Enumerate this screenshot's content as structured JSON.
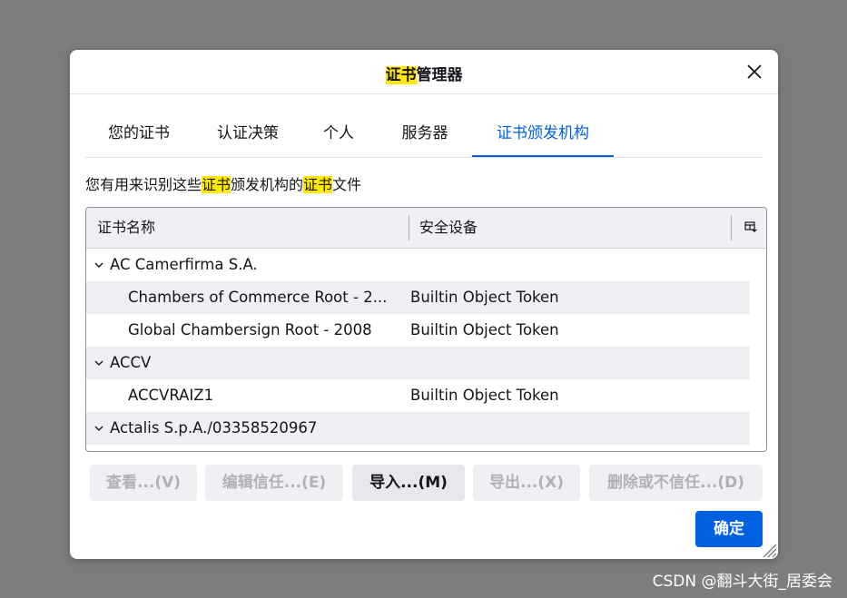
{
  "dialog": {
    "title_highlight": "证书",
    "title_rest": "管理器"
  },
  "tabs": [
    {
      "label": "您的证书"
    },
    {
      "label": "认证决策"
    },
    {
      "label": "个人"
    },
    {
      "label": "服务器"
    },
    {
      "label": "证书颁发机构",
      "selected": true
    }
  ],
  "description": {
    "part1": "您有用来识别这些",
    "hl1": "证书",
    "part2": "颁发机构的",
    "hl2": "证书",
    "part3": "文件"
  },
  "tree": {
    "columns": [
      "证书名称",
      "安全设备"
    ],
    "rows": [
      {
        "type": "group",
        "name": "AC Camerfirma S.A.",
        "token": ""
      },
      {
        "type": "item",
        "name": "Chambers of Commerce Root - 2...",
        "token": "Builtin Object Token"
      },
      {
        "type": "item",
        "name": "Global Chambersign Root - 2008",
        "token": "Builtin Object Token"
      },
      {
        "type": "group",
        "name": "ACCV",
        "token": ""
      },
      {
        "type": "item",
        "name": "ACCVRAIZ1",
        "token": "Builtin Object Token"
      },
      {
        "type": "group",
        "name": "Actalis S.p.A./03358520967",
        "token": ""
      }
    ]
  },
  "buttons": {
    "view": "查看...(V)",
    "edit_trust": "编辑信任...(E)",
    "import": "导入...(M)",
    "export": "导出...(X)",
    "delete": "删除或不信任...(D)",
    "ok": "确定"
  },
  "watermark": "CSDN @翻斗大街_居委会",
  "colors": {
    "accent": "#0060df",
    "highlight": "#ffe900",
    "backdrop": "#7d7d7d"
  }
}
